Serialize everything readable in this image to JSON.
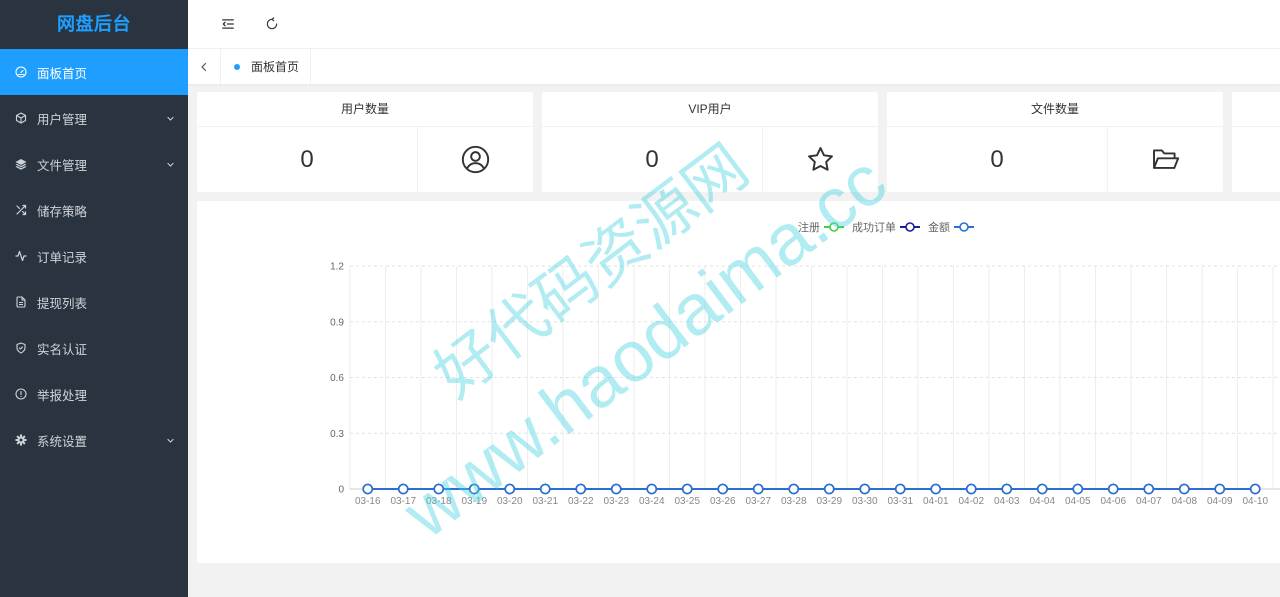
{
  "app": {
    "title": "网盘后台"
  },
  "sidebar": {
    "items": [
      {
        "label": "面板首页",
        "icon": "dashboard-icon",
        "active": true,
        "has_children": false
      },
      {
        "label": "用户管理",
        "icon": "cube-icon",
        "active": false,
        "has_children": true
      },
      {
        "label": "文件管理",
        "icon": "layers-icon",
        "active": false,
        "has_children": true
      },
      {
        "label": "储存策略",
        "icon": "shuffle-icon",
        "active": false,
        "has_children": false
      },
      {
        "label": "订单记录",
        "icon": "activity-icon",
        "active": false,
        "has_children": false
      },
      {
        "label": "提现列表",
        "icon": "document-icon",
        "active": false,
        "has_children": false
      },
      {
        "label": "实名认证",
        "icon": "shield-check-icon",
        "active": false,
        "has_children": false
      },
      {
        "label": "举报处理",
        "icon": "alert-circle-icon",
        "active": false,
        "has_children": false
      },
      {
        "label": "系统设置",
        "icon": "gear-icon",
        "active": false,
        "has_children": true
      }
    ]
  },
  "header": {
    "menu_icon": "menu-fold-icon",
    "refresh_icon": "refresh-icon"
  },
  "tabs": {
    "back_icon": "chevron-left-icon",
    "items": [
      {
        "label": "面板首页",
        "active": true
      }
    ]
  },
  "stats": [
    {
      "title": "用户数量",
      "value": "0",
      "icon": "user-circle-icon"
    },
    {
      "title": "VIP用户",
      "value": "0",
      "icon": "star-icon"
    },
    {
      "title": "文件数量",
      "value": "0",
      "icon": "folder-open-icon"
    }
  ],
  "colors": {
    "sidebar_bg": "#2a3440",
    "accent": "#1e9fff",
    "content_bg": "#f2f2f2"
  },
  "chart_data": {
    "type": "line",
    "categories": [
      "03-16",
      "03-17",
      "03-18",
      "03-19",
      "03-20",
      "03-21",
      "03-22",
      "03-23",
      "03-24",
      "03-25",
      "03-26",
      "03-27",
      "03-28",
      "03-29",
      "03-30",
      "03-31",
      "04-01",
      "04-02",
      "04-03",
      "04-04",
      "04-05",
      "04-06",
      "04-07",
      "04-08",
      "04-09",
      "04-10"
    ],
    "series": [
      {
        "name": "注册",
        "color": "#3fd13f",
        "values": [
          0,
          0,
          0,
          0,
          0,
          0,
          0,
          0,
          0,
          0,
          0,
          0,
          0,
          0,
          0,
          0,
          0,
          0,
          0,
          0,
          0,
          0,
          0,
          0,
          0,
          0
        ]
      },
      {
        "name": "成功订单",
        "color": "#1c1c9e",
        "values": [
          0,
          0,
          0,
          0,
          0,
          0,
          0,
          0,
          0,
          0,
          0,
          0,
          0,
          0,
          0,
          0,
          0,
          0,
          0,
          0,
          0,
          0,
          0,
          0,
          0,
          0
        ]
      },
      {
        "name": "金额",
        "color": "#2b6fd6",
        "values": [
          0,
          0,
          0,
          0,
          0,
          0,
          0,
          0,
          0,
          0,
          0,
          0,
          0,
          0,
          0,
          0,
          0,
          0,
          0,
          0,
          0,
          0,
          0,
          0,
          0,
          0
        ]
      }
    ],
    "ylim": [
      0,
      1.2
    ],
    "yticks": [
      0,
      0.3,
      0.6,
      0.9,
      1.2
    ],
    "grid": true,
    "legend": "top",
    "markers": "hollow-circle"
  },
  "watermark": {
    "line1": "好代码资源网",
    "line2": "www.haodaima.cc"
  }
}
